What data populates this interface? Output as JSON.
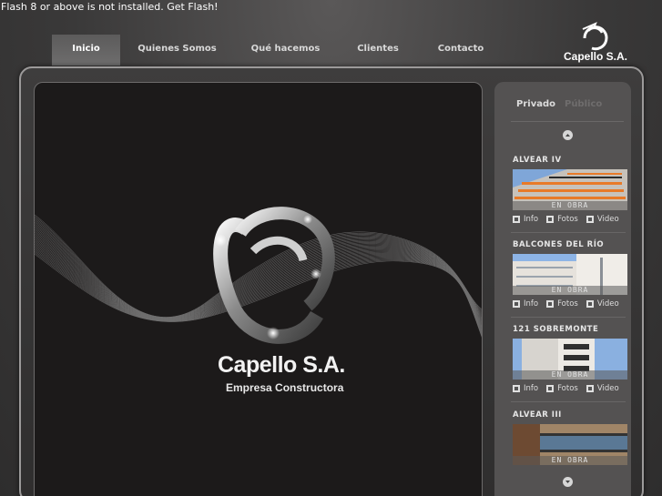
{
  "flash_notice": "Flash 8 or above is not installed. Get Flash!",
  "nav": {
    "items": [
      {
        "label": "Inicio",
        "active": true
      },
      {
        "label": "Quienes Somos",
        "active": false
      },
      {
        "label": "Qué hacemos",
        "active": false
      },
      {
        "label": "Clientes",
        "active": false
      },
      {
        "label": "Contacto",
        "active": false
      }
    ]
  },
  "header_logo": {
    "text": "Capello S.A.",
    "icon": "capello-ring-logo-icon"
  },
  "hero": {
    "title": "Capello S.A.",
    "subtitle": "Empresa Constructora",
    "icon": "capello-ring-emblem-icon"
  },
  "sidebar": {
    "tabs": [
      {
        "label": "Privado",
        "active": true
      },
      {
        "label": "Público",
        "active": false
      }
    ],
    "scroll_up_icon": "chevron-up-icon",
    "scroll_down_icon": "chevron-down-icon",
    "projects": [
      {
        "title": "ALVEAR IV",
        "status": "EN OBRA",
        "links": [
          "Info",
          "Fotos",
          "Video"
        ]
      },
      {
        "title": "BALCONES DEL RÍO",
        "status": "EN OBRA",
        "links": [
          "Info",
          "Fotos",
          "Video"
        ]
      },
      {
        "title": "121 SOBREMONTE",
        "status": "EN OBRA",
        "links": [
          "Info",
          "Fotos",
          "Video"
        ]
      },
      {
        "title": "ALVEAR III",
        "status": "EN OBRA",
        "links": []
      }
    ]
  },
  "colors": {
    "background": "#3a3939",
    "panel": "#1c1a1a",
    "sidebar": "#545252",
    "nav_active": "#666565",
    "text_light": "#e6e6e6"
  }
}
